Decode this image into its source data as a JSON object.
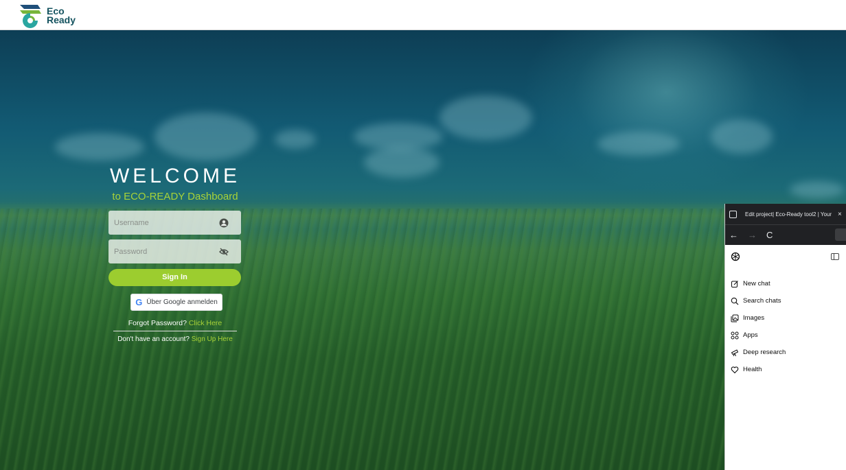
{
  "header": {
    "logo_line1": "Eco",
    "logo_line2": "Ready"
  },
  "login": {
    "title": "WELCOME",
    "subtitle": "to ECO-READY Dashboard",
    "username_placeholder": "Username",
    "password_placeholder": "Password",
    "signin_label": "Sign In",
    "google_label": "Über Google anmelden",
    "forgot_text": "Forgot Password?",
    "forgot_link": "Click Here",
    "signup_text": "Don't have an account?",
    "signup_link": "Sign Up Here",
    "accent_color": "#9ccd2f"
  },
  "browser": {
    "tab_title": "Edit project| Eco-Ready tool2 | Your",
    "tab_close": "×",
    "nav_back": "←",
    "nav_forward": "→",
    "nav_reload": "C",
    "menu": [
      {
        "label": "New chat",
        "icon": "edit-icon"
      },
      {
        "label": "Search chats",
        "icon": "search-icon"
      },
      {
        "label": "Images",
        "icon": "images-icon"
      },
      {
        "label": "Apps",
        "icon": "apps-icon"
      },
      {
        "label": "Deep research",
        "icon": "telescope-icon"
      },
      {
        "label": "Health",
        "icon": "heart-icon"
      }
    ]
  }
}
